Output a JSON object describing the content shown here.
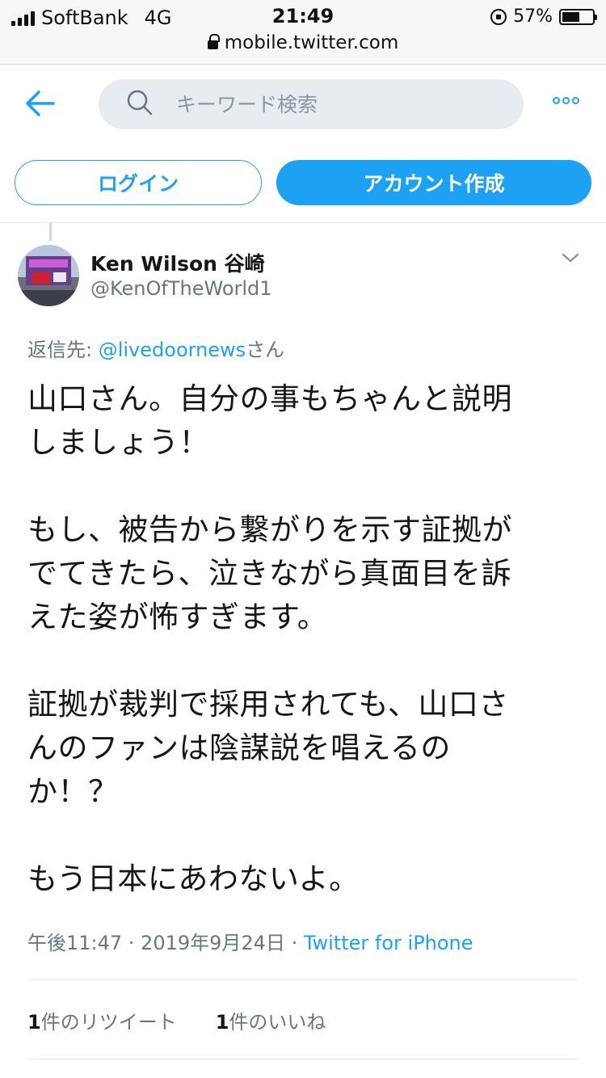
{
  "status_bar": {
    "carrier": "SoftBank",
    "network": "4G",
    "time": "21:49",
    "battery": "57%",
    "battery_level": 0.57,
    "url": "mobile.twitter.com"
  },
  "header": {
    "search_placeholder": "キーワード検索",
    "login_label": "ログイン",
    "signup_label": "アカウント作成"
  },
  "tweet": {
    "author_name": "Ken Wilson 谷崎",
    "author_handle": "@KenOfTheWorld1",
    "reply_prefix": "返信先: ",
    "reply_mention": "@livedoornews",
    "reply_suffix": "さん",
    "body_lines": [
      "山口さん。自分の事もちゃんと説明",
      "しましょう！",
      "",
      "もし、被告から繋がりを示す証拠が",
      "でてきたら、泣きながら真面目を訴",
      "えた姿が怖すぎます。",
      "",
      "証拠が裁判で採用されても、山口さ",
      "んのファンは陰謀説を唱えるの",
      "か！？",
      "",
      "もう日本にあわないよ。"
    ],
    "timestamp": "午後11:47 · 2019年9月24日",
    "meta_sep": " · ",
    "source": "Twitter for iPhone",
    "retweet_count": "1",
    "retweet_label": "件のリツイート",
    "like_count": "1",
    "like_label": "件のいいね"
  },
  "colors": {
    "accent": "#1da1f2",
    "muted": "#657786",
    "text": "#14171a"
  },
  "icons": [
    "back-arrow-icon",
    "search-icon",
    "more-icon",
    "chevron-down-icon",
    "lock-icon",
    "rotation-lock-icon",
    "battery-icon",
    "signal-icon"
  ]
}
